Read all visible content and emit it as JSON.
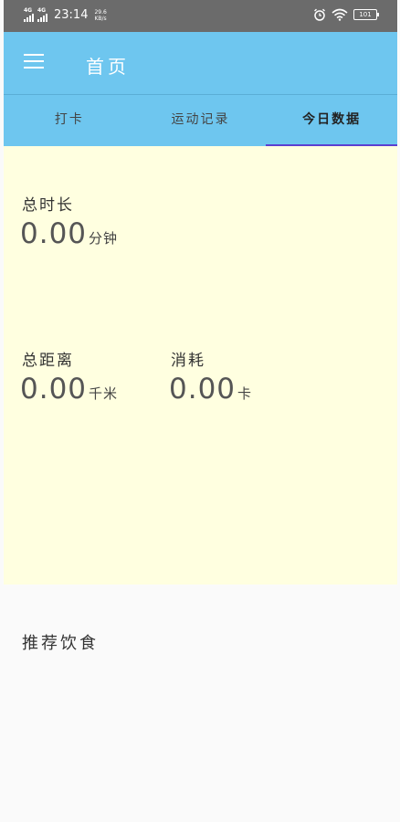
{
  "status_bar": {
    "network_1": "4G",
    "network_2": "4G",
    "time": "23:14",
    "speed_value": "29.6",
    "speed_unit": "KB/s",
    "battery": "101"
  },
  "app_bar": {
    "title": "首页",
    "menu_icon": "hamburger-menu-icon"
  },
  "tabs": [
    {
      "label": "打卡",
      "active": false
    },
    {
      "label": "运动记录",
      "active": false
    },
    {
      "label": "今日数据",
      "active": true
    }
  ],
  "stats": {
    "total_time": {
      "label": "总时长",
      "value": "0.00",
      "unit": "分钟"
    },
    "total_distance": {
      "label": "总距离",
      "value": "0.00",
      "unit": "千米"
    },
    "consumption": {
      "label": "消耗",
      "value": "0.00",
      "unit": "卡"
    }
  },
  "diet": {
    "title": "推荐饮食"
  },
  "colors": {
    "app_bar": "#6ec6ef",
    "tab_indicator": "#5b3fd1",
    "stats_background": "#ffffe0",
    "status_bar": "#6b6b6b"
  }
}
